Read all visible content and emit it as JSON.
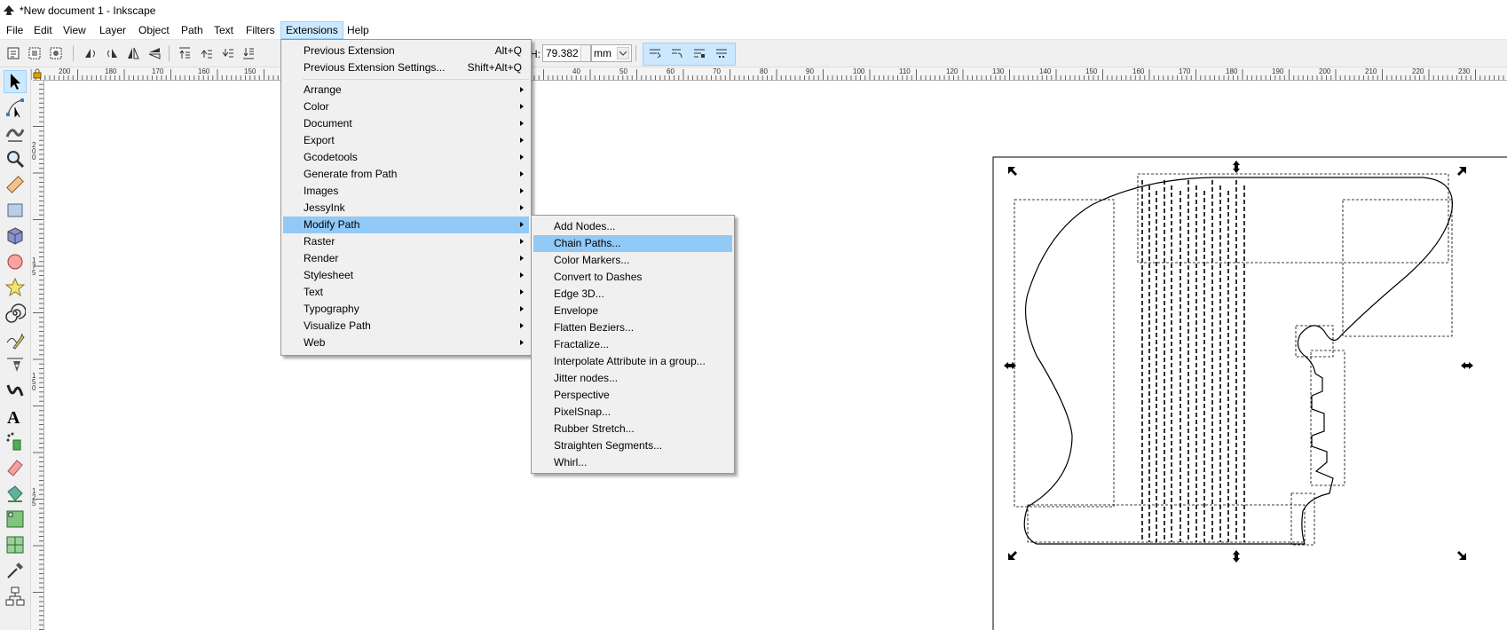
{
  "window": {
    "title": "*New document 1 - Inkscape"
  },
  "menubar": [
    {
      "id": "file",
      "label": "File"
    },
    {
      "id": "edit",
      "label": "Edit"
    },
    {
      "id": "view",
      "label": "View"
    },
    {
      "id": "layer",
      "label": "Layer"
    },
    {
      "id": "object",
      "label": "Object"
    },
    {
      "id": "path",
      "label": "Path"
    },
    {
      "id": "text",
      "label": "Text"
    },
    {
      "id": "filters",
      "label": "Filters"
    },
    {
      "id": "extensions",
      "label": "Extensions"
    },
    {
      "id": "help",
      "label": "Help"
    }
  ],
  "toolbar": {
    "h_label": "H:",
    "h_value": "79.382",
    "unit": "mm"
  },
  "extensions_menu": {
    "previous_extension": "Previous Extension",
    "previous_extension_accel": "Alt+Q",
    "previous_extension_settings": "Previous Extension Settings...",
    "previous_extension_settings_accel": "Shift+Alt+Q",
    "submenus": [
      "Arrange",
      "Color",
      "Document",
      "Export",
      "Gcodetools",
      "Generate from Path",
      "Images",
      "JessyInk",
      "Modify Path",
      "Raster",
      "Render",
      "Stylesheet",
      "Text",
      "Typography",
      "Visualize Path",
      "Web"
    ],
    "highlighted": "Modify Path"
  },
  "modify_path_menu": {
    "items": [
      "Add Nodes...",
      "Chain Paths...",
      "Color Markers...",
      "Convert to Dashes",
      "Edge 3D...",
      "Envelope",
      "Flatten Beziers...",
      "Fractalize...",
      "Interpolate Attribute in a group...",
      "Jitter nodes...",
      "Perspective",
      "PixelSnap...",
      "Rubber Stretch...",
      "Straighten Segments...",
      "Whirl..."
    ],
    "highlighted": "Chain Paths..."
  },
  "hruler_labels": [
    "200",
    "180",
    "170",
    "160",
    "150",
    "40",
    "50",
    "60",
    "70",
    "80",
    "90",
    "100",
    "110",
    "120",
    "130",
    "140",
    "150",
    "160",
    "170",
    "180",
    "190",
    "200",
    "210",
    "220",
    "230"
  ],
  "vruler_labels": [
    "200",
    "175",
    "150",
    "125"
  ],
  "colors": {
    "menu_highlight": "#91c9f7",
    "active_bg": "#cce8ff",
    "active_border": "#99d1ff"
  },
  "icons": [
    "inkscape-logo-icon",
    "selector-tool-icon",
    "node-tool-icon",
    "tweak-tool-icon",
    "zoom-tool-icon",
    "measure-tool-icon",
    "rect-tool-icon",
    "3dbox-tool-icon",
    "circle-tool-icon",
    "star-tool-icon",
    "spiral-tool-icon",
    "pencil-tool-icon",
    "pen-tool-icon",
    "calligraphy-tool-icon",
    "text-tool-icon",
    "spray-tool-icon",
    "eraser-tool-icon",
    "paint-bucket-tool-icon",
    "gradient-tool-icon",
    "mesh-tool-icon",
    "dropper-tool-icon",
    "connector-tool-icon"
  ]
}
